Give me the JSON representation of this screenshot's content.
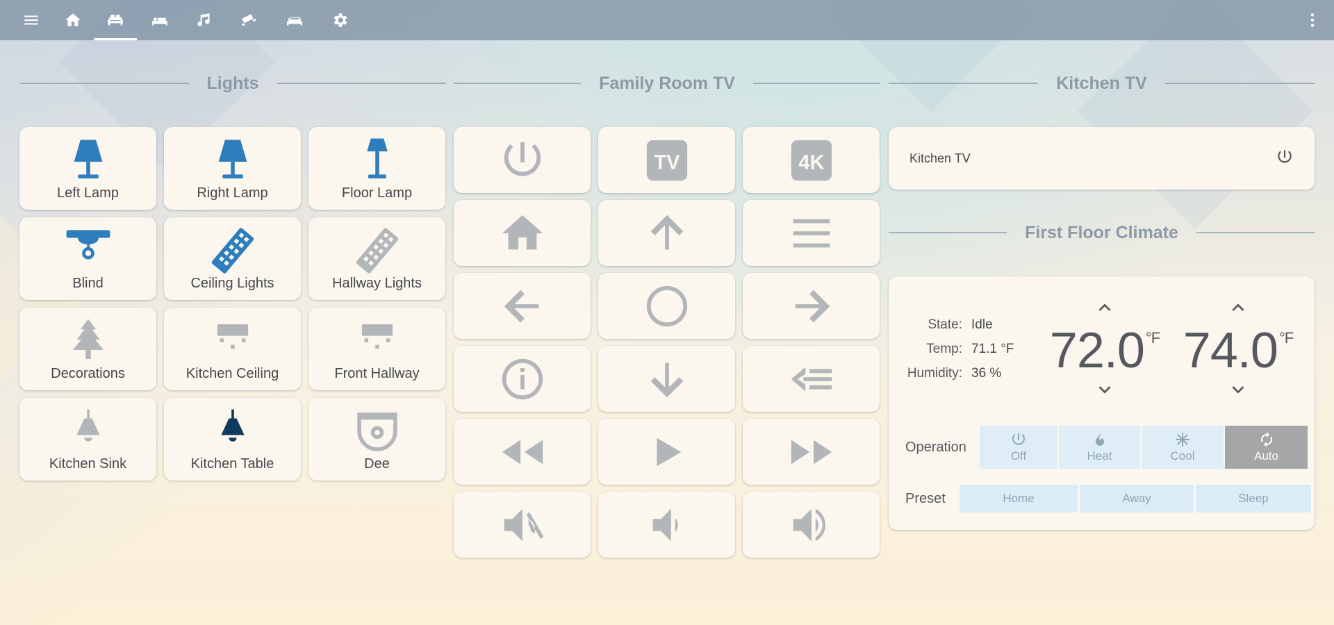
{
  "topbar": {
    "tabs": [
      {
        "icon": "hamburger-menu-icon"
      },
      {
        "icon": "home-icon"
      },
      {
        "icon": "sofa-icon",
        "active": true
      },
      {
        "icon": "bed-icon"
      },
      {
        "icon": "music-note-icon"
      },
      {
        "icon": "security-camera-icon"
      },
      {
        "icon": "bed-outline-icon"
      },
      {
        "icon": "gear-icon"
      }
    ],
    "overflow_icon": "dots-vertical-icon"
  },
  "sections": {
    "lights": "Lights",
    "family_tv": "Family Room TV",
    "kitchen_tv": "Kitchen TV",
    "climate": "First Floor Climate"
  },
  "lights": [
    {
      "label": "Left Lamp",
      "icon": "table-lamp-icon",
      "color": "#2e7dbc"
    },
    {
      "label": "Right Lamp",
      "icon": "table-lamp-icon",
      "color": "#2e7dbc"
    },
    {
      "label": "Floor Lamp",
      "icon": "floor-lamp-icon",
      "color": "#2e7dbc"
    },
    {
      "label": "Blind",
      "icon": "ceiling-light-icon",
      "color": "#2e7dbc"
    },
    {
      "label": "Ceiling Lights",
      "icon": "led-strip-icon",
      "color": "#2e7dbc"
    },
    {
      "label": "Hallway Lights",
      "icon": "led-strip-icon",
      "color": "#b3b6b9"
    },
    {
      "label": "Decorations",
      "icon": "pine-tree-icon",
      "color": "#b3b6b9"
    },
    {
      "label": "Kitchen Ceiling",
      "icon": "track-light-icon",
      "color": "#b3b6b9"
    },
    {
      "label": "Front Hallway",
      "icon": "track-light-icon",
      "color": "#b3b6b9"
    },
    {
      "label": "Kitchen Sink",
      "icon": "pendant-light-icon",
      "color": "#b3b6b9"
    },
    {
      "label": "Kitchen Table",
      "icon": "pendant-light-icon",
      "color": "#103a5c"
    },
    {
      "label": "Dee",
      "icon": "robot-vacuum-icon",
      "color": "#b3b6b9"
    }
  ],
  "remote": [
    {
      "name": "power-button",
      "icon": "power-icon"
    },
    {
      "name": "tv-button",
      "icon": "tv-icon",
      "text": "TV"
    },
    {
      "name": "4k-button",
      "icon": "4k-icon",
      "text": "4K"
    },
    {
      "name": "home-button",
      "icon": "home-icon"
    },
    {
      "name": "up-button",
      "icon": "arrow-up-icon"
    },
    {
      "name": "menu-button",
      "icon": "menu-icon"
    },
    {
      "name": "left-button",
      "icon": "arrow-left-icon"
    },
    {
      "name": "select-button",
      "icon": "circle-outline-icon"
    },
    {
      "name": "right-button",
      "icon": "arrow-right-icon"
    },
    {
      "name": "info-button",
      "icon": "info-icon"
    },
    {
      "name": "down-button",
      "icon": "arrow-down-icon"
    },
    {
      "name": "back-button",
      "icon": "back-icon"
    },
    {
      "name": "rewind-button",
      "icon": "rewind-icon"
    },
    {
      "name": "play-button",
      "icon": "play-icon"
    },
    {
      "name": "fast-forward-button",
      "icon": "fast-forward-icon"
    },
    {
      "name": "mute-button",
      "icon": "volume-mute-icon"
    },
    {
      "name": "volume-down-button",
      "icon": "volume-low-icon"
    },
    {
      "name": "volume-up-button",
      "icon": "volume-high-icon"
    }
  ],
  "kitchen_tv": {
    "name": "Kitchen TV",
    "icon": "power-icon"
  },
  "climate": {
    "state_label": "State:",
    "state": "Idle",
    "temp_label": "Temp:",
    "temp": "71.1 °F",
    "humidity_label": "Humidity:",
    "humidity": "36 %",
    "low_setpoint": "72.0",
    "high_setpoint": "74.0",
    "unit": "°F",
    "operation_label": "Operation",
    "operations": [
      {
        "label": "Off",
        "icon": "power-icon"
      },
      {
        "label": "Heat",
        "icon": "fire-icon"
      },
      {
        "label": "Cool",
        "icon": "snowflake-icon"
      },
      {
        "label": "Auto",
        "icon": "autorenew-icon",
        "active": true
      }
    ],
    "preset_label": "Preset",
    "presets": [
      "Home",
      "Away",
      "Sleep"
    ]
  }
}
